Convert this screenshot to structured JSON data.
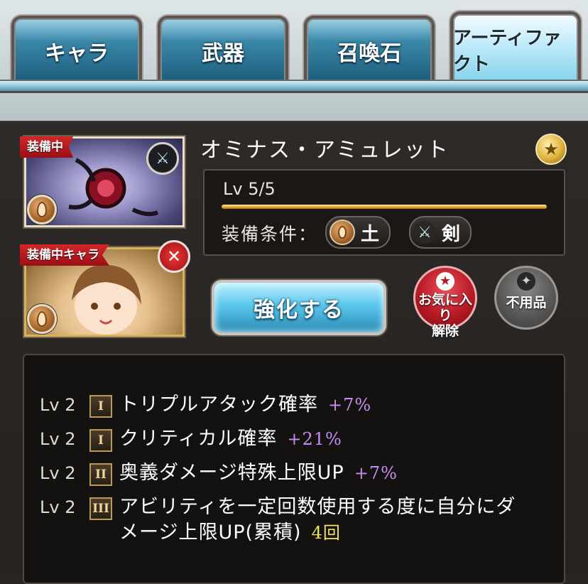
{
  "tabs": [
    {
      "label": "キャラ",
      "active": false
    },
    {
      "label": "武器",
      "active": false
    },
    {
      "label": "召喚石",
      "active": false
    },
    {
      "label": "アーティファクト",
      "active": true
    }
  ],
  "artifact": {
    "equipped_badge": "装備中",
    "equipped_chara_badge": "装備中キャラ",
    "name": "オミナス・アミュレット",
    "level": "Lv 5/5",
    "level_progress": 1.0,
    "condition_label": "装備条件：",
    "conditions": [
      {
        "icon": "earth-element-icon",
        "label": "土"
      },
      {
        "icon": "sword-icon",
        "label": "剣"
      }
    ]
  },
  "actions": {
    "upgrade": "強化する",
    "favorite_remove_line1": "お気に入り",
    "favorite_remove_line2": "解除",
    "junk": "不用品"
  },
  "skills": [
    {
      "lv": "Lv 2",
      "tier": "I",
      "name": "トリプルアタック確率",
      "value": "+7%",
      "value_color": "purple"
    },
    {
      "lv": "Lv 2",
      "tier": "I",
      "name": "クリティカル確率",
      "value": "+21%",
      "value_color": "purple"
    },
    {
      "lv": "Lv 2",
      "tier": "II",
      "name": "奥義ダメージ特殊上限UP",
      "value": "+7%",
      "value_color": "purple"
    },
    {
      "lv": "Lv 2",
      "tier": "III",
      "name_line1": "アビリティを一定回数使用する度に自分にダ",
      "name_line2": "メージ上限UP(累積)",
      "value": "4回",
      "value_color": "yellow"
    }
  ],
  "colors": {
    "purple": "#c98cf2",
    "yellow": "#f2e35a",
    "accent": "#5bc7ec",
    "ribbon": "#c8232a"
  }
}
